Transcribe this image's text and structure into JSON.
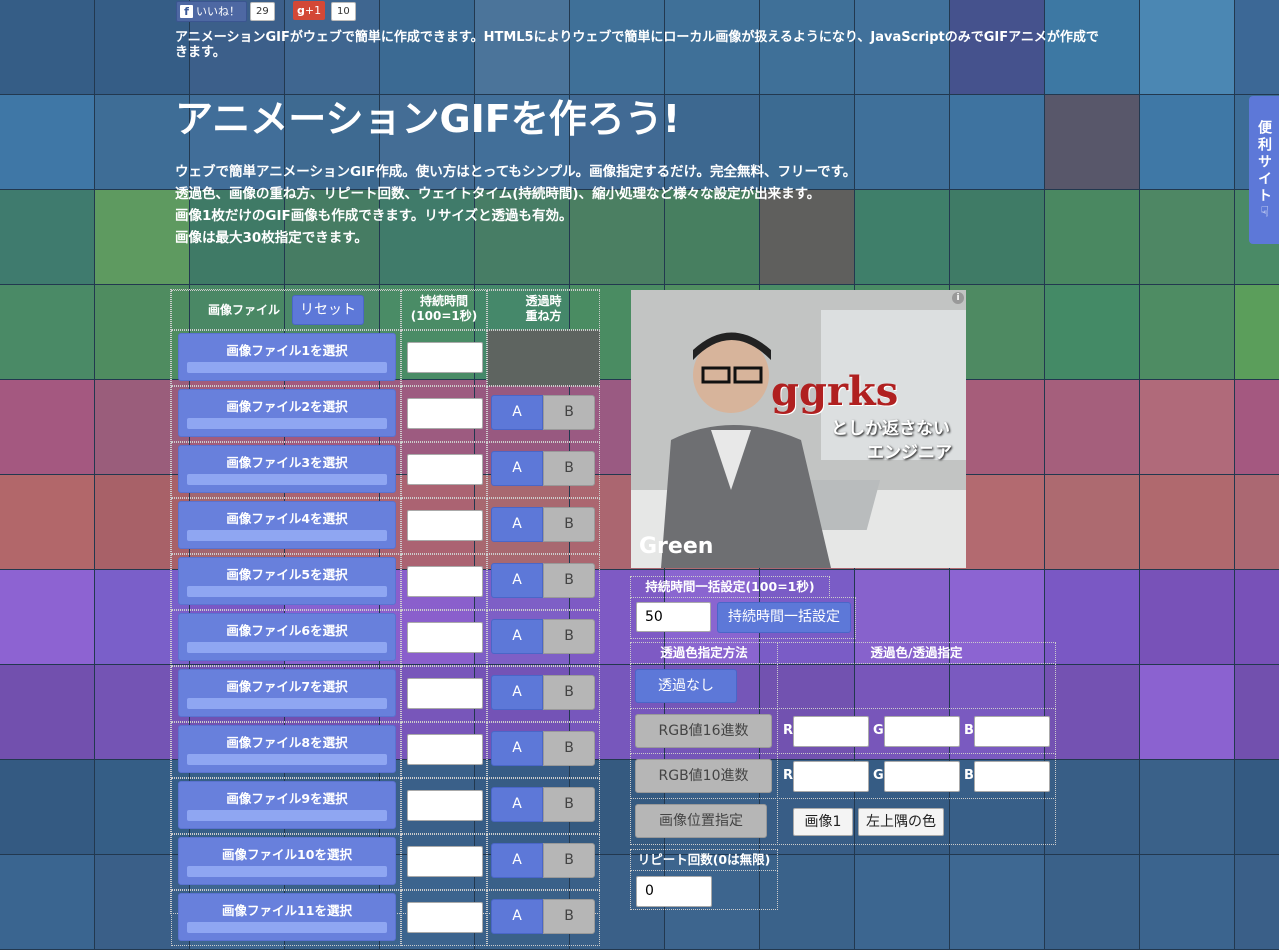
{
  "social": {
    "like_label": "いいね！",
    "like_count": "29",
    "gplus_label": "+1",
    "gplus_count": "10"
  },
  "intro": "アニメーションGIFがウェブで簡単に作成できます。HTML5によりウェブで簡単にローカル画像が扱えるようになり、JavaScriptのみでGIFアニメが作成できます。",
  "title": "アニメーションGIFを作ろう!",
  "description": [
    "ウェブで簡単アニメーションGIF作成。使い方はとってもシンプル。画像指定するだけ。完全無料、フリーです。",
    "透過色、画像の重ね方、リピート回数、ウェイトタイム(持続時間)、縮小処理など様々な設定が出来ます。",
    "画像1枚だけのGIF画像も作成できます。リサイズと透過も有効。",
    "画像は最大30枚指定できます。"
  ],
  "file_table": {
    "header_file": "画像ファイル",
    "reset_label": "リセット",
    "header_duration_1": "持続時間",
    "header_duration_2": "(100=1秒)",
    "header_overlay_1": "透過時",
    "header_overlay_2": "重ね方",
    "option_a": "A",
    "option_b": "B",
    "rows": [
      "画像ファイル1を選択",
      "画像ファイル2を選択",
      "画像ファイル3を選択",
      "画像ファイル4を選択",
      "画像ファイル5を選択",
      "画像ファイル6を選択",
      "画像ファイル7を選択",
      "画像ファイル8を選択",
      "画像ファイル9を選択",
      "画像ファイル10を選択",
      "画像ファイル11を選択"
    ]
  },
  "ad": {
    "headline": "ggrks",
    "line2": "としか返さない",
    "line3": "エンジニア",
    "brand": "Green",
    "info": "i"
  },
  "duration_bulk": {
    "label": "持続時間一括設定(100=1秒)",
    "value": "50",
    "button": "持続時間一括設定"
  },
  "transparency": {
    "header_method": "透過色指定方法",
    "header_value": "透過色/透過指定",
    "none_button": "透過なし",
    "hex_button": "RGB値16進数",
    "dec_button": "RGB値10進数",
    "pos_button": "画像位置指定",
    "r": "R",
    "g": "G",
    "b": "B",
    "image_button": "画像1",
    "corner_button": "左上隅の色"
  },
  "repeat": {
    "label": "リピート回数(0は無限)",
    "value": "0"
  },
  "side_tab": "便利サイト",
  "colors": {
    "accent": "#5d78d8",
    "file_button": "#6880dc",
    "gray_button": "#b6b6b6"
  }
}
